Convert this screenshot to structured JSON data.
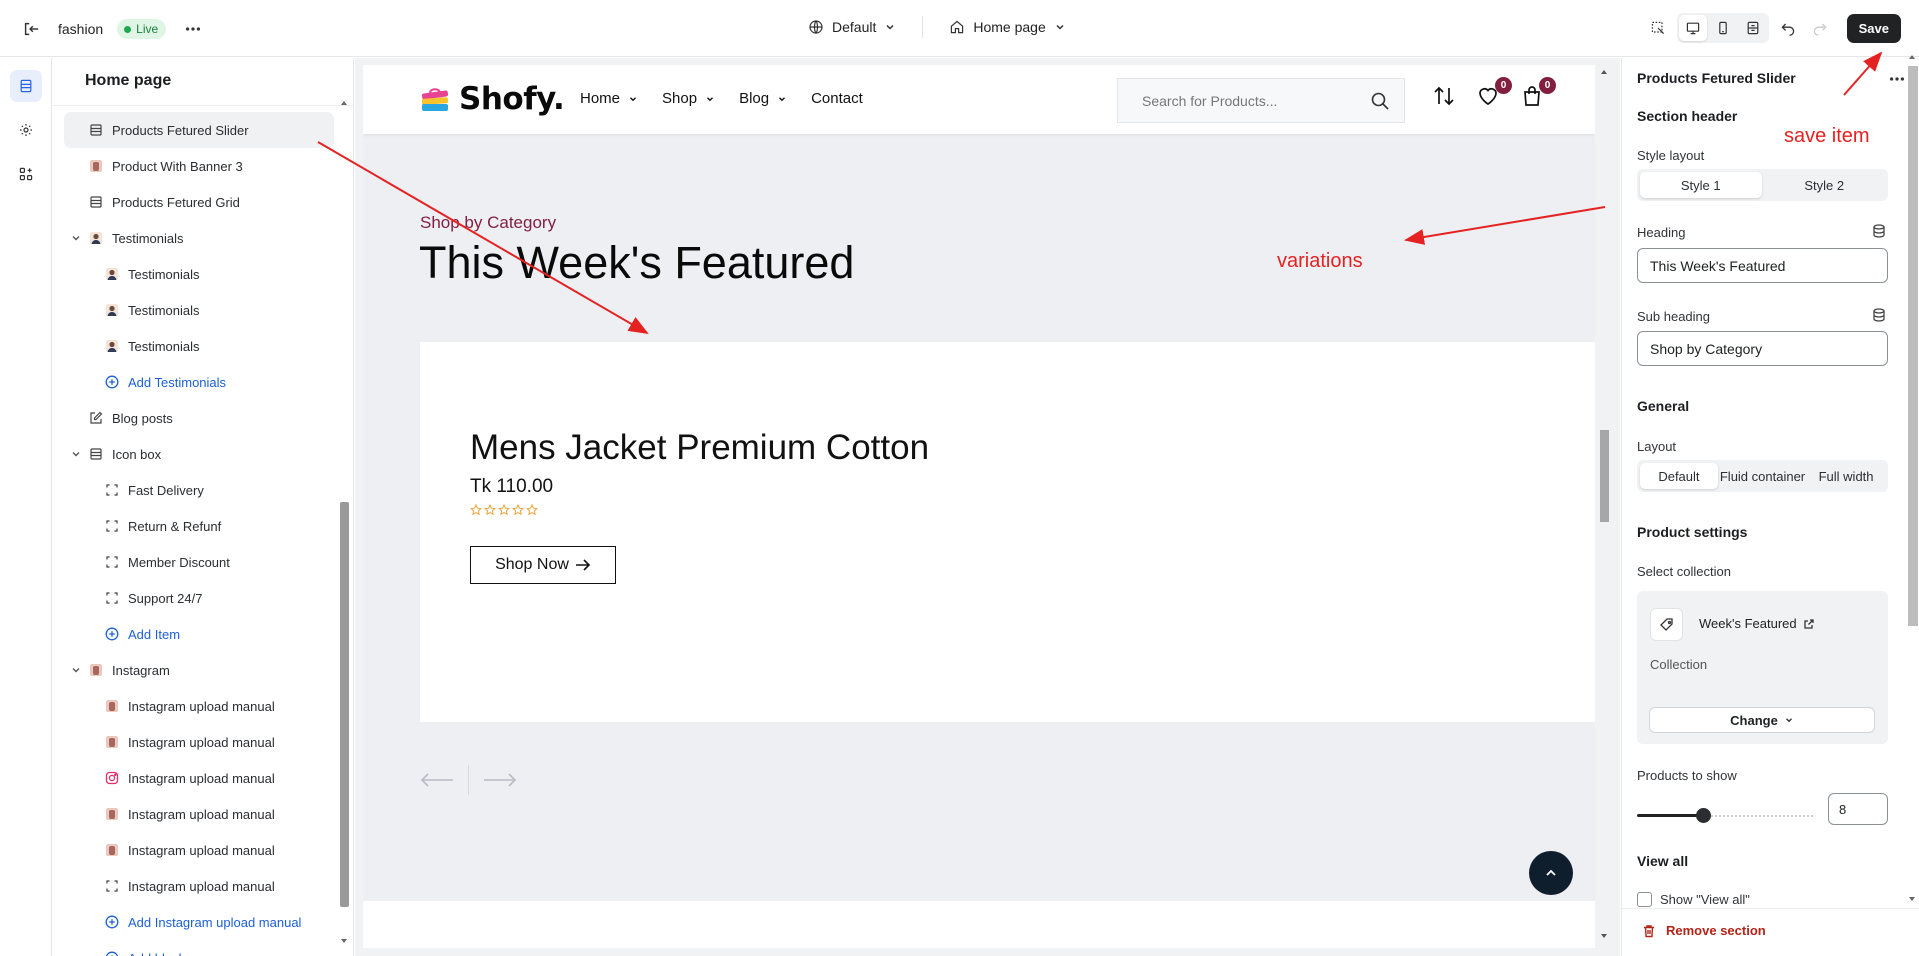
{
  "topbar": {
    "store_name": "fashion",
    "status_badge": "Live",
    "theme_select": "Default",
    "page_select": "Home page",
    "save_label": "Save"
  },
  "sidebar": {
    "title": "Home page",
    "items": [
      {
        "label": "Products Fetured Slider",
        "level": 1,
        "icon": "section-icon",
        "selected": true
      },
      {
        "label": "Product With Banner 3",
        "level": 1,
        "icon": "image-thumb"
      },
      {
        "label": "Products Fetured Grid",
        "level": 1,
        "icon": "section-icon"
      },
      {
        "label": "Testimonials",
        "level": 1,
        "icon": "avatar-thumb",
        "expanded": true
      },
      {
        "label": "Testimonials",
        "level": 2,
        "icon": "avatar-thumb"
      },
      {
        "label": "Testimonials",
        "level": 2,
        "icon": "avatar-thumb"
      },
      {
        "label": "Testimonials",
        "level": 2,
        "icon": "avatar-thumb"
      },
      {
        "label": "Add Testimonials",
        "level": 2,
        "icon": "plus-circle-icon",
        "add": true
      },
      {
        "label": "Blog posts",
        "level": 1,
        "icon": "edit-icon"
      },
      {
        "label": "Icon box",
        "level": 1,
        "icon": "section-icon",
        "expanded": true
      },
      {
        "label": "Fast Delivery",
        "level": 2,
        "icon": "block-icon"
      },
      {
        "label": "Return & Refunf",
        "level": 2,
        "icon": "block-icon"
      },
      {
        "label": "Member Discount",
        "level": 2,
        "icon": "block-icon"
      },
      {
        "label": "Support 24/7",
        "level": 2,
        "icon": "block-icon"
      },
      {
        "label": "Add Item",
        "level": 2,
        "icon": "plus-circle-icon",
        "add": true
      },
      {
        "label": "Instagram",
        "level": 1,
        "icon": "image-thumb",
        "expanded": true
      },
      {
        "label": "Instagram upload manual",
        "level": 2,
        "icon": "image-thumb"
      },
      {
        "label": "Instagram upload manual",
        "level": 2,
        "icon": "image-thumb"
      },
      {
        "label": "Instagram upload manual",
        "level": 2,
        "icon": "instagram-icon"
      },
      {
        "label": "Instagram upload manual",
        "level": 2,
        "icon": "image-thumb"
      },
      {
        "label": "Instagram upload manual",
        "level": 2,
        "icon": "image-thumb"
      },
      {
        "label": "Instagram upload manual",
        "level": 2,
        "icon": "block-icon"
      },
      {
        "label": "Add Instagram upload manual",
        "level": 2,
        "icon": "plus-circle-icon",
        "add": true
      },
      {
        "label": "Add block",
        "level": 2,
        "icon": "plus-circle-icon",
        "add": true
      }
    ]
  },
  "preview": {
    "logo": "Shofy.",
    "nav": [
      "Home",
      "Shop",
      "Blog",
      "Contact"
    ],
    "search_placeholder": "Search for Products...",
    "wishlist_count": "0",
    "cart_count": "0",
    "subheading": "Shop by Category",
    "heading": "This Week's Featured",
    "product": {
      "title": "Mens Jacket Premium Cotton",
      "price": "Tk 110.00",
      "button": "Shop Now",
      "rating": 0
    }
  },
  "panel": {
    "title": "Products Fetured Slider",
    "section_header": "Section header",
    "style_layout_label": "Style layout",
    "style_options": [
      "Style 1",
      "Style 2"
    ],
    "style_selected": "Style 1",
    "heading_label": "Heading",
    "heading_value": "This Week's Featured",
    "subheading_label": "Sub heading",
    "subheading_value": "Shop by Category",
    "general": "General",
    "layout_label": "Layout",
    "layout_options": [
      "Default",
      "Fluid container",
      "Full width"
    ],
    "layout_selected": "Default",
    "product_settings": "Product settings",
    "select_collection_label": "Select collection",
    "collection_name": "Week's Featured",
    "collection_type": "Collection",
    "change_label": "Change",
    "products_to_show_label": "Products to show",
    "products_to_show": "8",
    "view_all": "View all",
    "show_view_all": "Show \"View all\"",
    "remove_section": "Remove section"
  },
  "annotations": {
    "save_item": "save item",
    "variations": "variations"
  },
  "colors": {
    "accent": "#821f40",
    "annotation": "#e52222",
    "primary_button": "#202223"
  }
}
